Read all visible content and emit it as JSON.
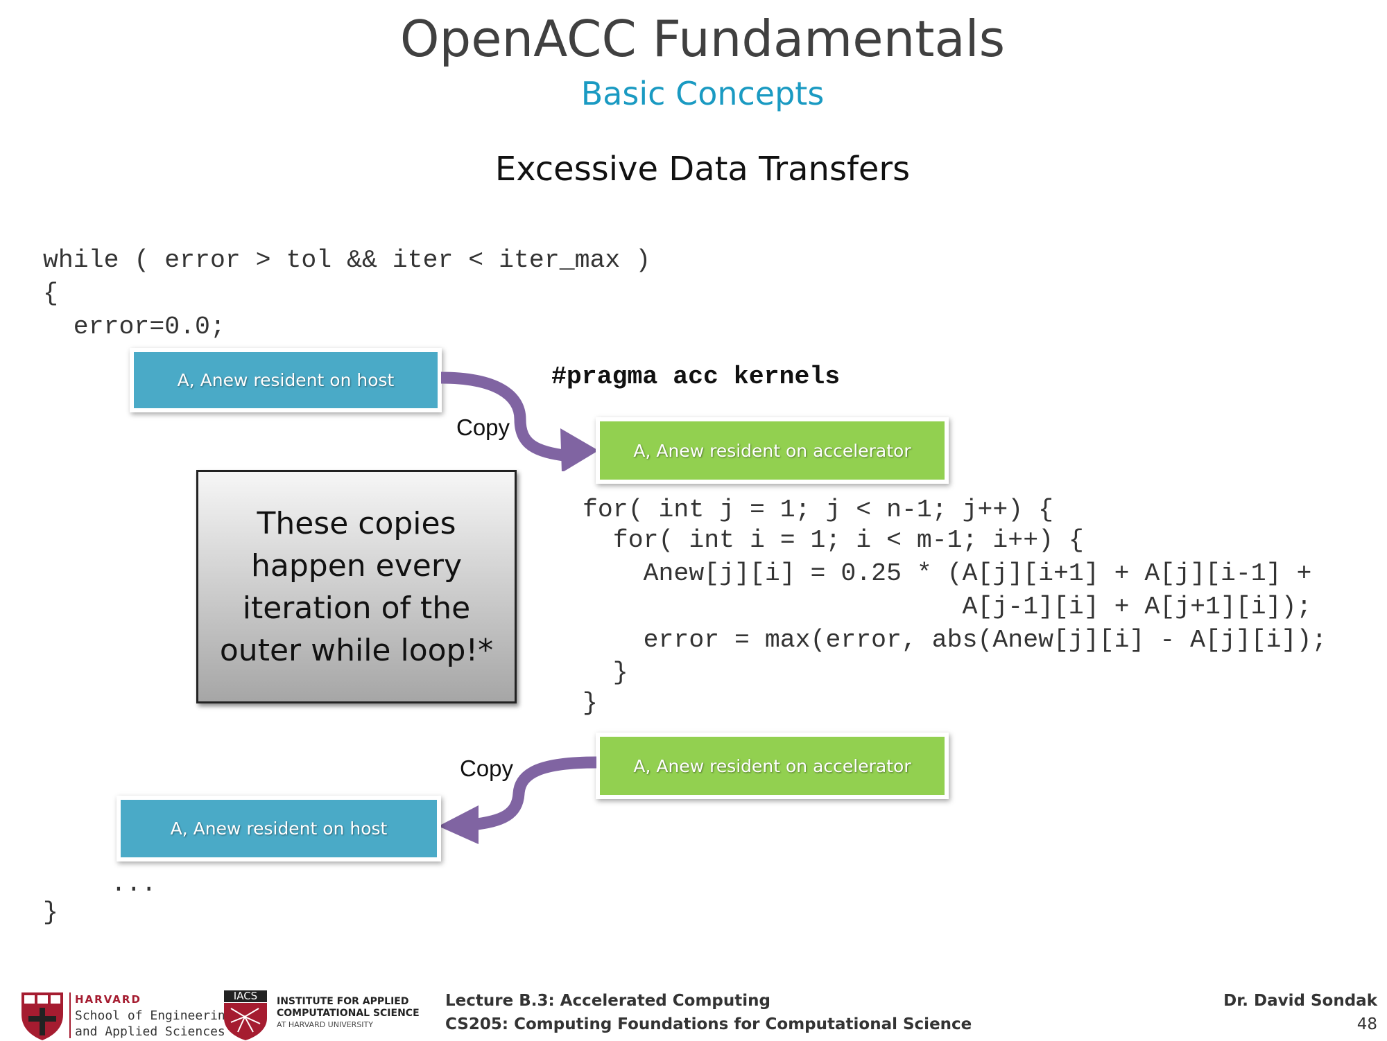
{
  "header": {
    "title": "OpenACC Fundamentals",
    "subtitle": "Basic Concepts",
    "slide_heading": "Excessive Data Transfers"
  },
  "code": {
    "while_line": "while ( error > tol && iter < iter_max )",
    "open_brace": "{",
    "error_init": "  error=0.0;",
    "pragma": "#pragma acc kernels",
    "loop_lines": [
      "for( int j = 1; j < n-1; j++) {",
      "  for( int i = 1; i < m-1; i++) {",
      "    Anew[j][i] = 0.25 * (A[j][i+1] + A[j][i-1] +",
      "                         A[j-1][i] + A[j+1][i]);",
      "    error = max(error, abs(Anew[j][i] - A[j][i]);",
      "  }",
      "}"
    ],
    "ellipsis": "...",
    "close_brace": "}"
  },
  "diagram": {
    "host_top": "A, Anew resident on host",
    "accel_top": "A, Anew resident on accelerator",
    "accel_bottom": "A, Anew resident on accelerator",
    "host_bottom": "A, Anew resident on host",
    "copy_top": "Copy",
    "copy_bottom": "Copy",
    "arrow_color": "#8064a2",
    "host_color": "#4aaac7",
    "accel_color": "#92d050"
  },
  "note": {
    "lines": [
      "These copies",
      "happen every",
      "iteration of the",
      "outer while loop!*"
    ]
  },
  "footer": {
    "harvard_word": "HARVARD",
    "seas_line1": "School of Engineering",
    "seas_line2": "and Applied Sciences",
    "iacs_badge": "IACS",
    "iacs_line1": "INSTITUTE FOR APPLIED",
    "iacs_line2": "COMPUTATIONAL SCIENCE",
    "iacs_line3": "AT HARVARD UNIVERSITY",
    "lecture": "Lecture B.3: Accelerated Computing",
    "course": "CS205: Computing Foundations for Computational Science",
    "author": "Dr. David Sondak",
    "page_number": "48",
    "harvard_red": "#a51c30"
  }
}
